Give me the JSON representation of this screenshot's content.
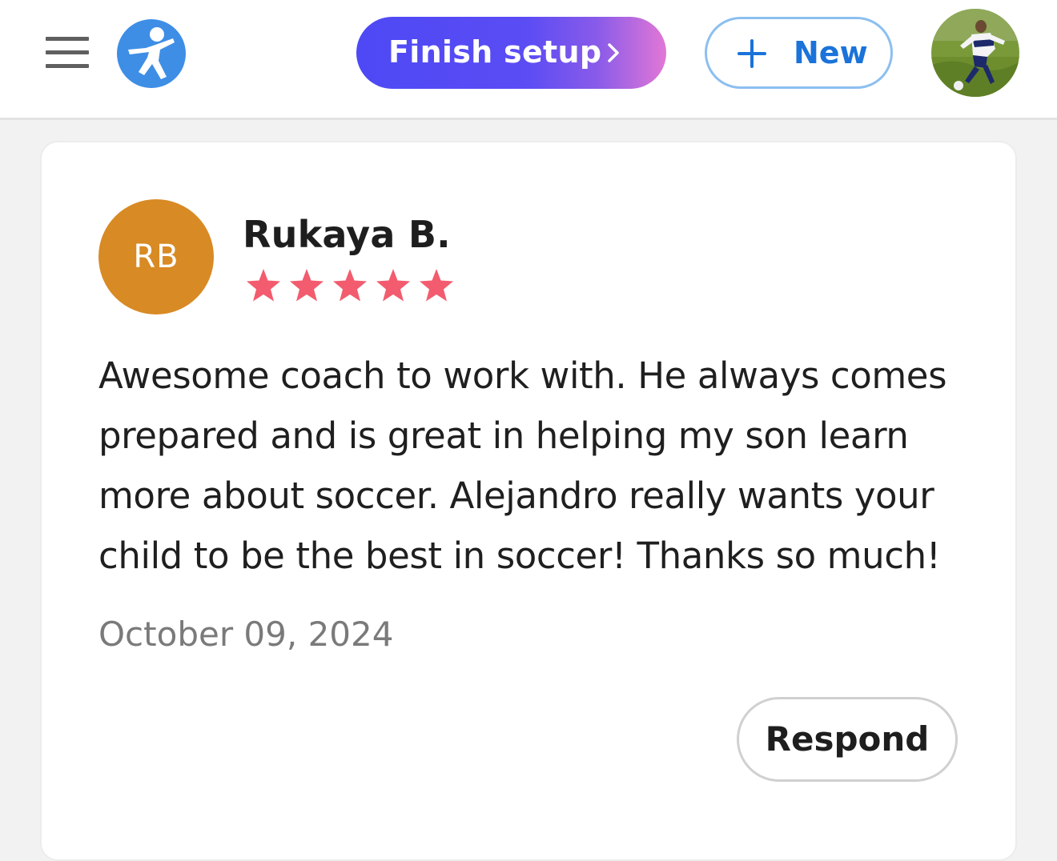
{
  "header": {
    "menu_icon": "hamburger-menu-icon",
    "logo_icon": "running-person-logo-icon",
    "finish_setup_label": "Finish setup",
    "finish_setup_icon": "chevron-right-icon",
    "new_label": "New",
    "new_icon": "plus-icon",
    "profile_icon": "profile-avatar-photo",
    "colors": {
      "logo_bg": "#3e8ee6",
      "finish_gradient_start": "#4d49f5",
      "finish_gradient_end": "#e277d6",
      "new_accent": "#1a73d9"
    }
  },
  "review": {
    "initials": "RB",
    "initials_bg": "#d88a24",
    "reviewer_name": "Rukaya B.",
    "rating": 5,
    "rating_max": 5,
    "star_color": "#f25c6e",
    "text": "Awesome coach to work with. He always comes prepared and is great in helping my son learn more about soccer. Alejandro really wants your child to be the best in soccer! Thanks so much!",
    "date": "October 09, 2024",
    "respond_label": "Respond"
  }
}
